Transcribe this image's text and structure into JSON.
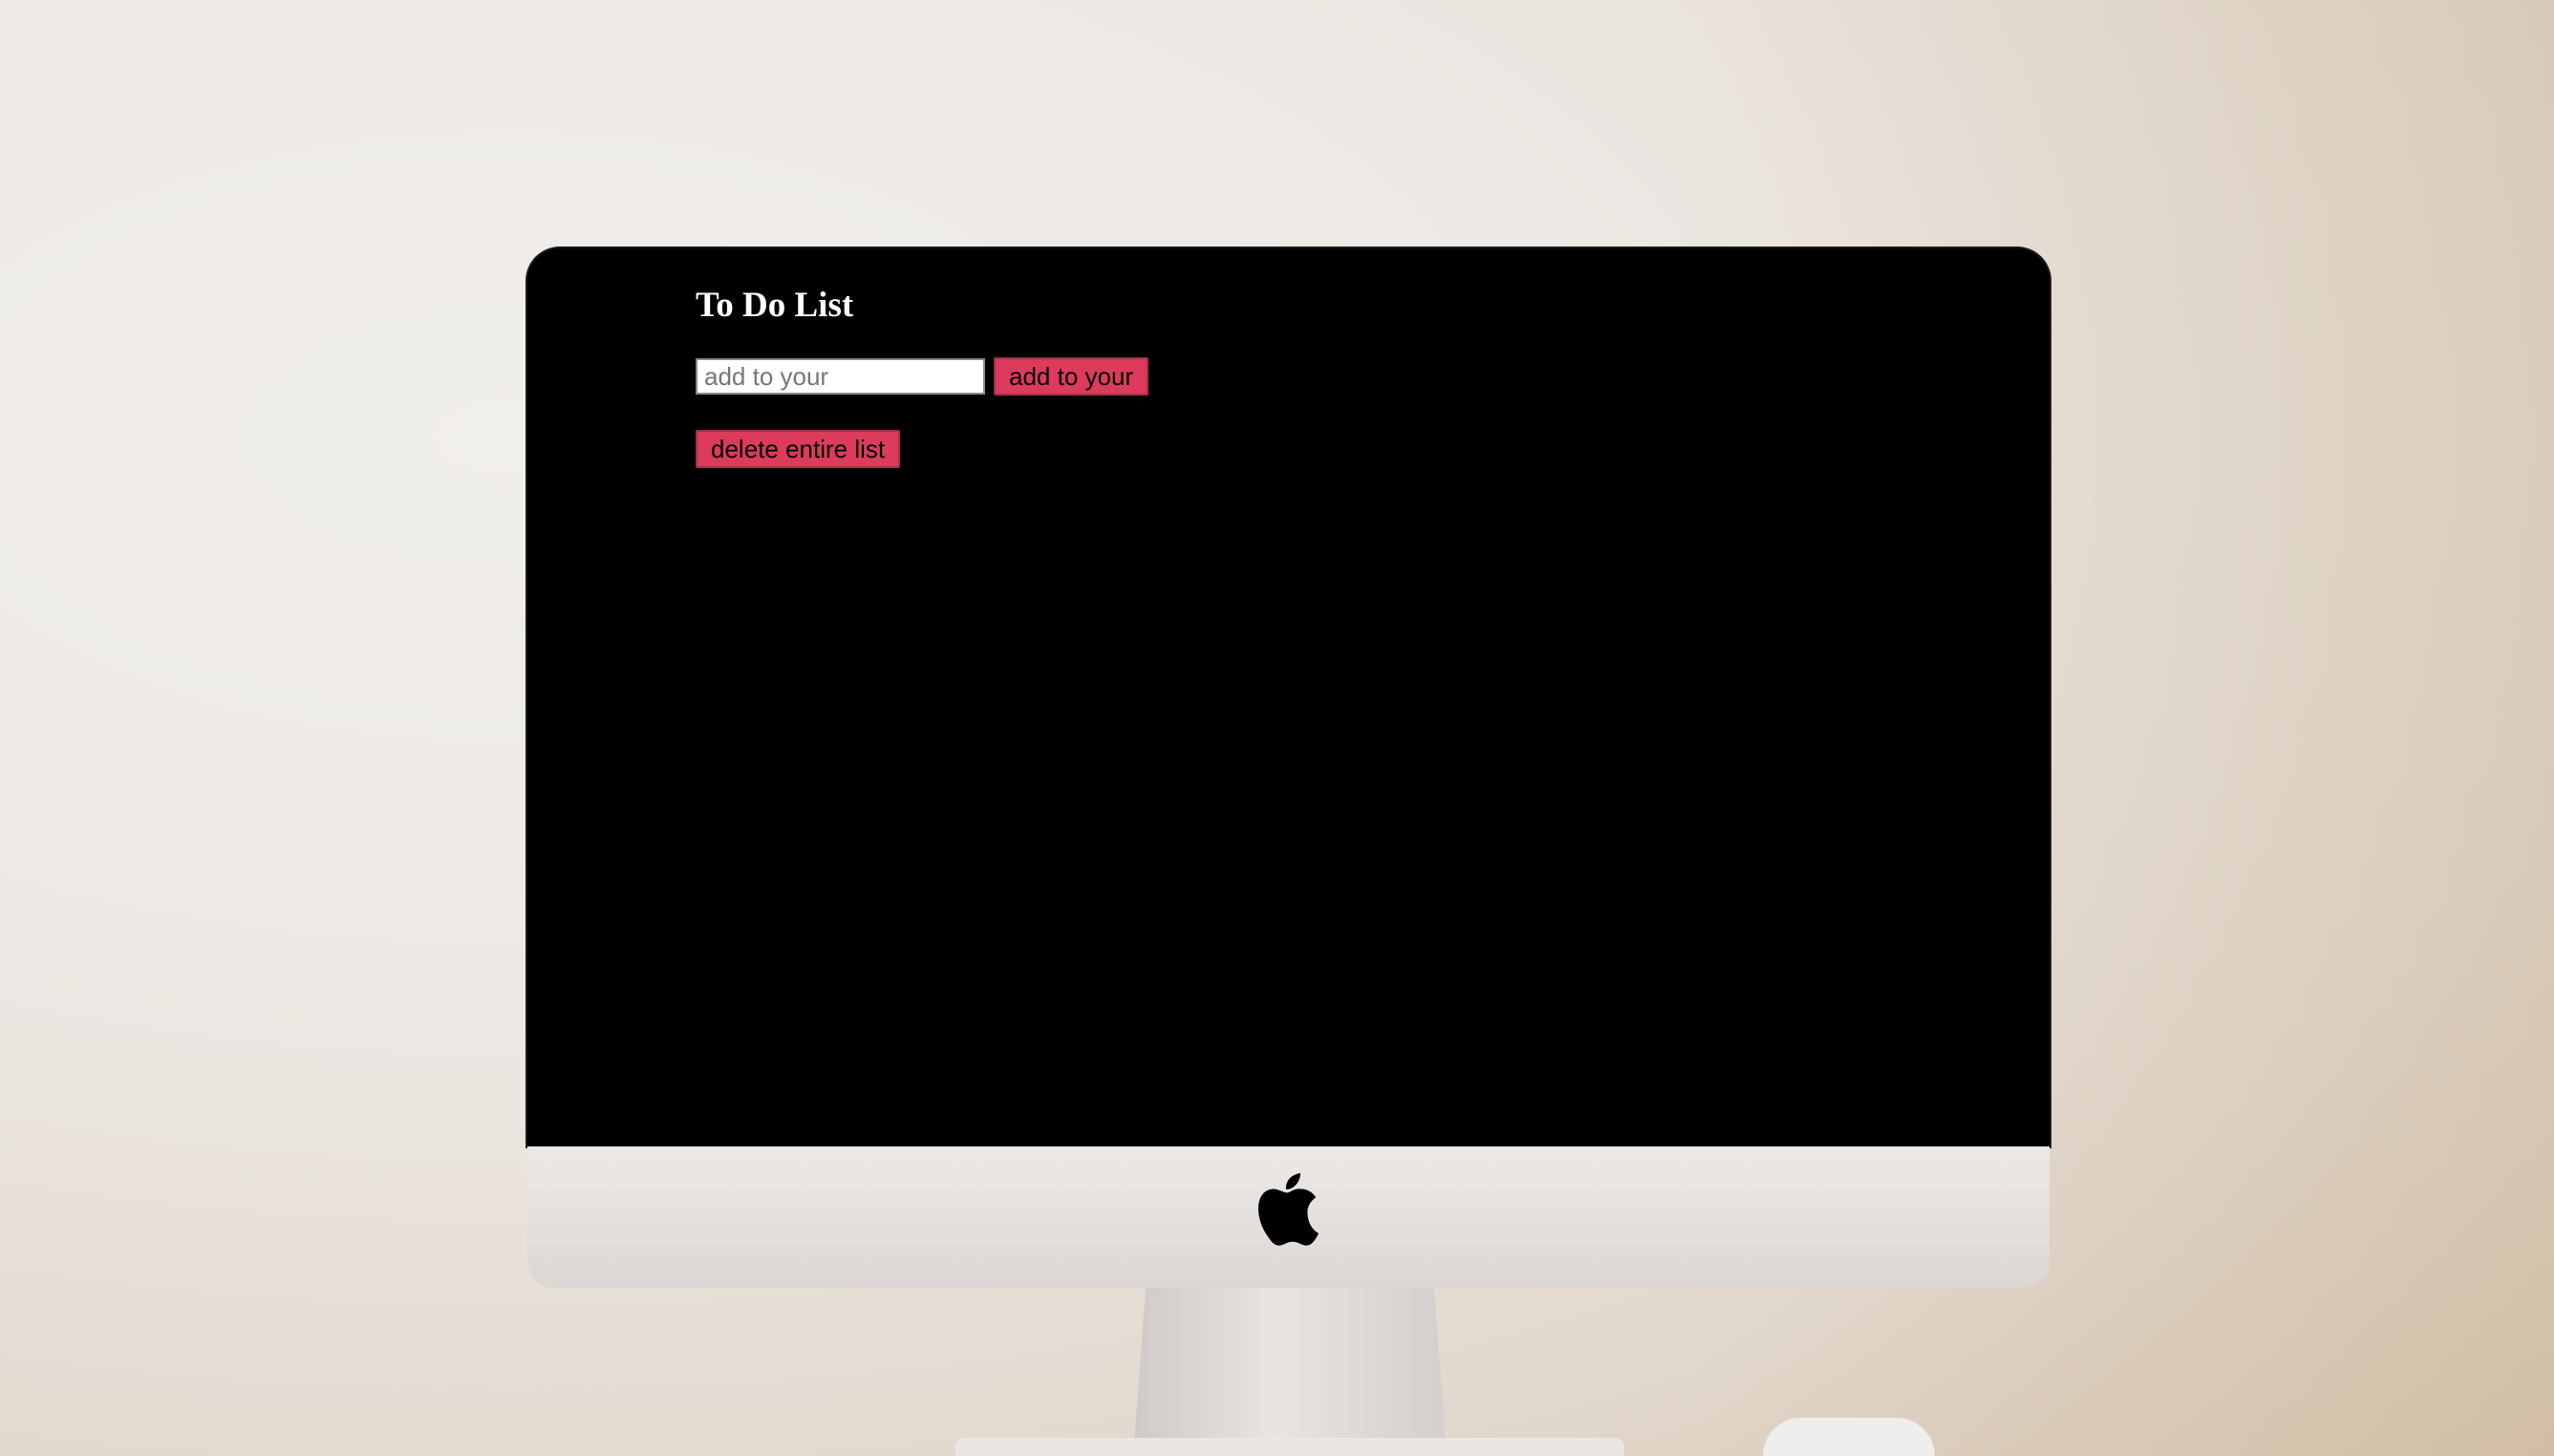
{
  "app": {
    "title": "To Do List",
    "input_placeholder": "add to your",
    "add_button_label": "add to your",
    "delete_button_label": "delete entire list"
  },
  "colors": {
    "screen_background": "#000000",
    "button_background": "#dc3b5b",
    "title_text": "#ffffff"
  },
  "icons": {
    "monitor_logo": "apple-logo-icon"
  }
}
